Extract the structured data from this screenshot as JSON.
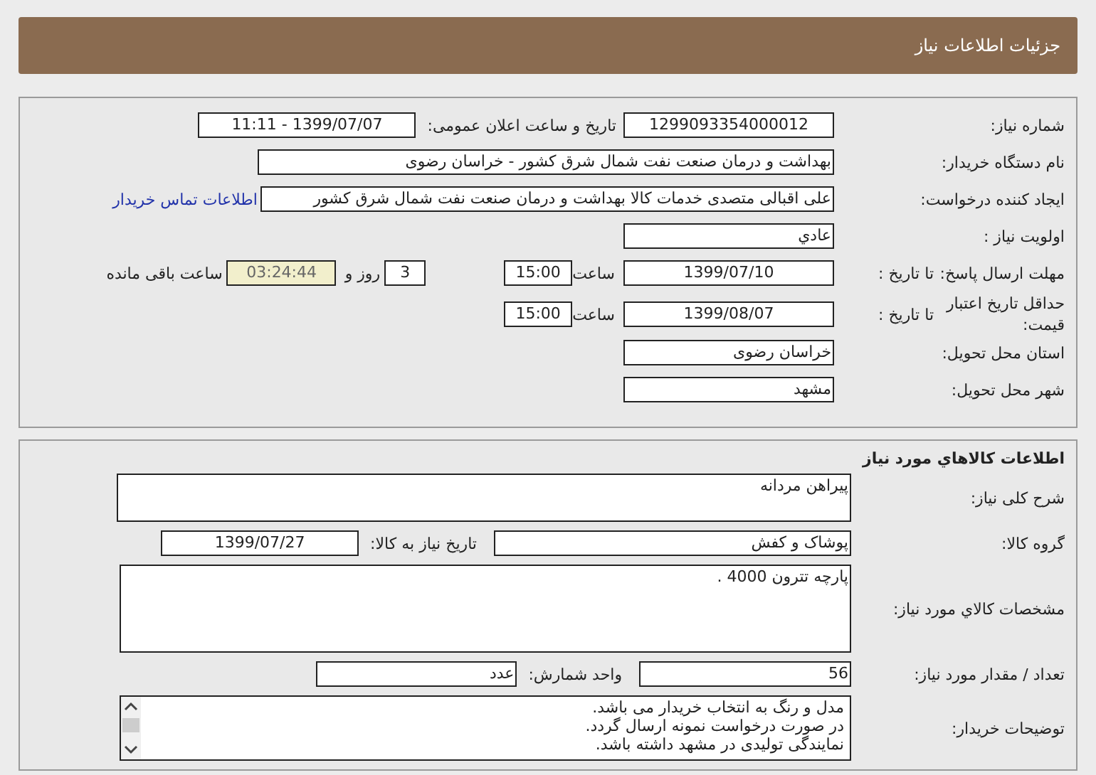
{
  "header": {
    "title": "جزئیات اطلاعات نیاز"
  },
  "need_info": {
    "need_number": {
      "label": "شماره نیاز:",
      "value": "1299093354000012"
    },
    "announce_datetime": {
      "label": "تاریخ و ساعت اعلان عمومی:",
      "value": "1399/07/07 - 11:11"
    },
    "buyer_org": {
      "label": "نام دستگاه خریدار:",
      "value": "بهداشت و درمان صنعت نفت شمال شرق کشور - خراسان رضوی"
    },
    "requester": {
      "label": "ایجاد کننده درخواست:",
      "value": "علی اقبالی متصدی خدمات کالا بهداشت و درمان صنعت نفت شمال شرق کشور",
      "link": "اطلاعات تماس خریدار"
    },
    "priority": {
      "label": "اولویت نیاز :",
      "value": "عادي"
    },
    "response_deadline": {
      "label": "مهلت ارسال پاسخ:",
      "date_label": "تا تاریخ :",
      "date": "1399/07/10",
      "time_label": "ساعت",
      "time": "15:00",
      "days": "3",
      "days_label": "روز و",
      "remaining": "03:24:44",
      "remaining_label": "ساعت باقی مانده"
    },
    "price_validity": {
      "label": "حداقل تاریخ اعتبار قیمت:",
      "date_label": "تا تاریخ :",
      "date": "1399/08/07",
      "time_label": "ساعت",
      "time": "15:00"
    },
    "province": {
      "label": "استان محل تحویل:",
      "value": "خراسان رضوی"
    },
    "city": {
      "label": "شهر محل تحویل:",
      "value": "مشهد"
    }
  },
  "goods_info": {
    "title": "اطلاعات کالاهاي مورد نیاز",
    "summary": {
      "label": "شرح کلی نیاز:",
      "value": "پیراهن مردانه"
    },
    "group": {
      "label": "گروه کالا:",
      "value": "پوشاک و کفش"
    },
    "need_date": {
      "label": "تاریخ نیاز به کالا:",
      "value": "1399/07/27"
    },
    "specs": {
      "label": "مشخصات کالاي مورد نیاز:",
      "value": "پارچه تترون 4000 ."
    },
    "quantity": {
      "label": "تعداد / مقدار مورد نیاز:",
      "value": "56"
    },
    "unit": {
      "label": "واحد شمارش:",
      "value": "عدد"
    },
    "buyer_notes": {
      "label": "توضیحات خریدار:",
      "lines": [
        "مدل و رنگ به انتخاب خریدار می باشد.",
        "در صورت درخواست نمونه ارسال گردد.",
        "نمایندگی تولیدی در مشهد داشته باشد."
      ]
    }
  }
}
